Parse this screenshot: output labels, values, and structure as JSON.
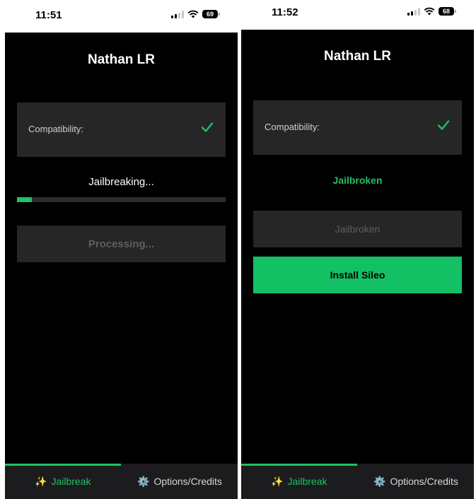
{
  "left": {
    "status_time": "11:51",
    "battery": "69",
    "title": "Nathan LR",
    "compatibility_label": "Compatibility:",
    "status_text": "Jailbreaking...",
    "progress_fraction": 0.07,
    "action_button": "Processing...",
    "tabs": [
      {
        "label": "Jailbreak",
        "icon": "sparkles-icon",
        "selected": true
      },
      {
        "label": "Options/Credits",
        "icon": "gear-icon",
        "selected": false
      }
    ]
  },
  "right": {
    "status_time": "11:52",
    "battery": "68",
    "title": "Nathan LR",
    "compatibility_label": "Compatibility:",
    "status_text": "Jailbroken",
    "action_button": "Jailbroken",
    "install_button": "Install Sileo",
    "tabs": [
      {
        "label": "Jailbreak",
        "icon": "sparkles-icon",
        "selected": true
      },
      {
        "label": "Options/Credits",
        "icon": "gear-icon",
        "selected": false
      }
    ]
  },
  "colors": {
    "accent": "#20c065",
    "background": "#000000",
    "card": "#262626",
    "tabbar": "#1c1c1e"
  }
}
